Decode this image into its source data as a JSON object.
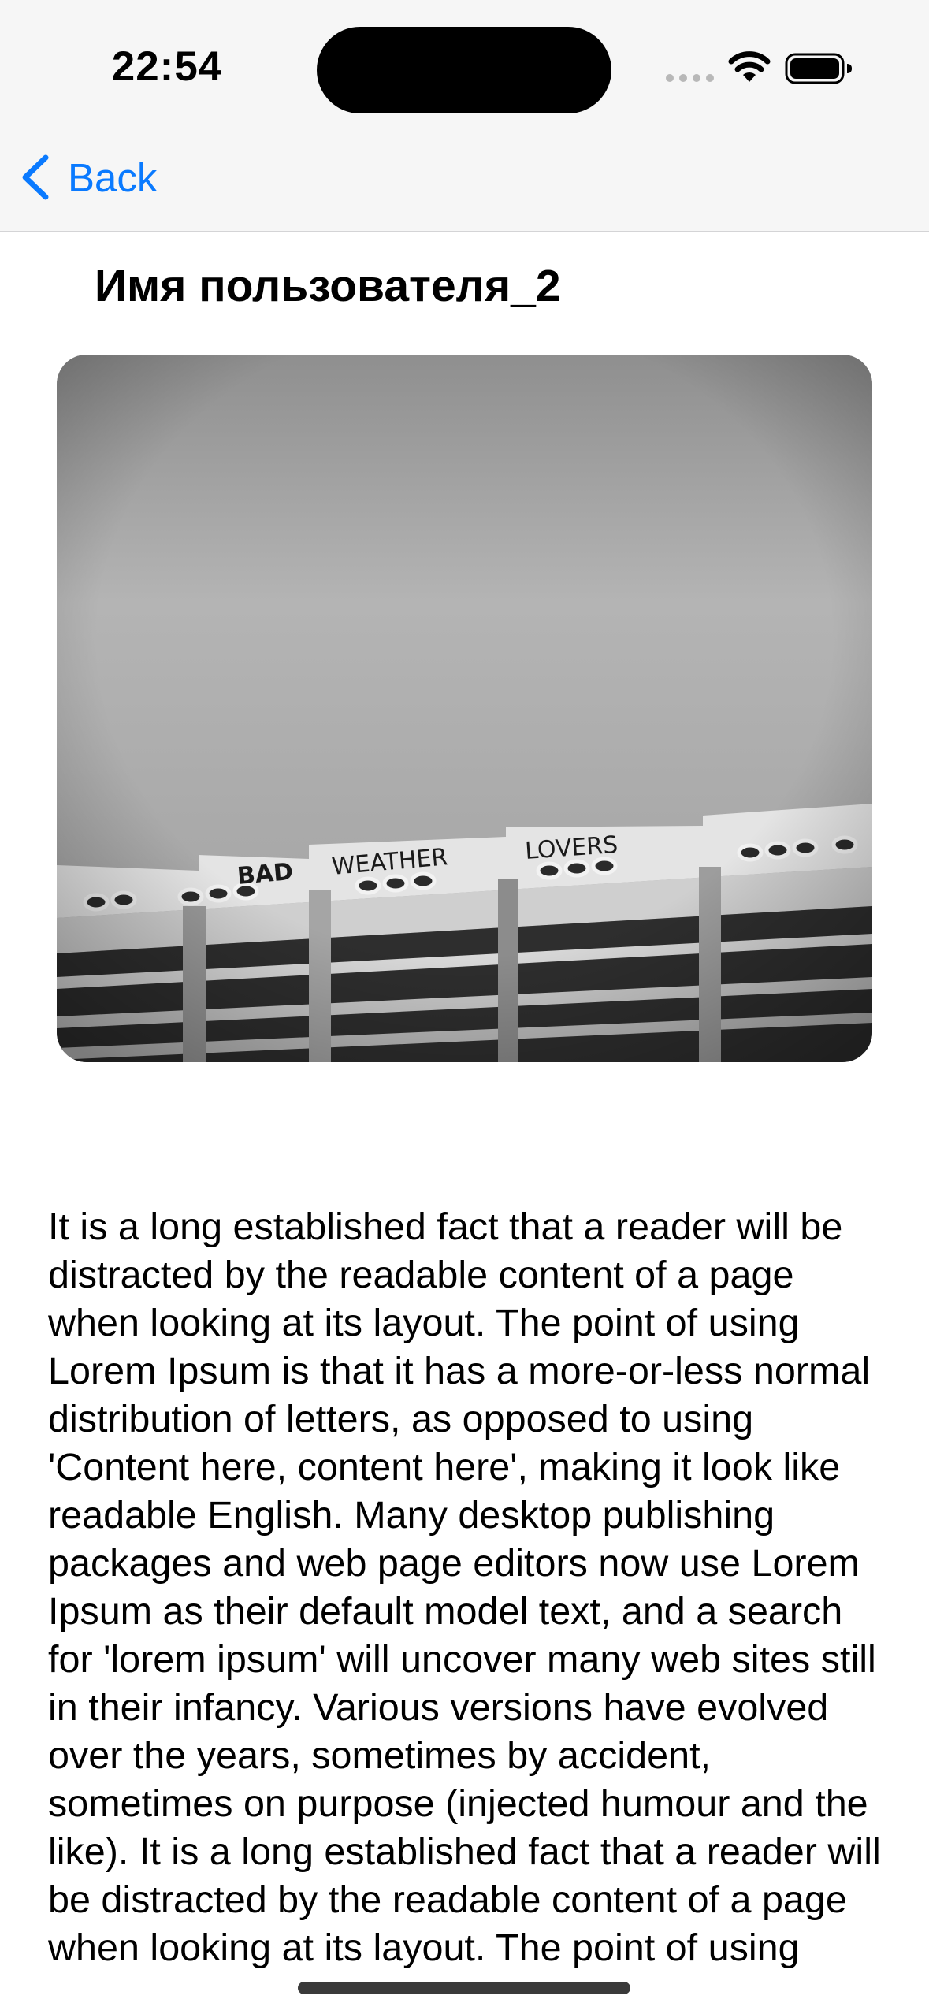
{
  "status_bar": {
    "time": "22:54"
  },
  "nav": {
    "back_label": "Back"
  },
  "post": {
    "username": "Имя пользователя_2",
    "image_graffiti": "BAD WEATHER LOVERS",
    "text": "It is a long established fact that a reader will be distracted by the readable content of a page when looking at its layout. The point of using Lorem Ipsum is that it has a more-or-less normal distribution of letters, as opposed to using 'Content here, content here', making it look like readable English. Many desktop publishing packages and web page editors now use Lorem Ipsum as their default model text, and a search for 'lorem ipsum' will uncover many web sites still in their infancy. Various versions have evolved over the years, sometimes by accident, sometimes on purpose (injected humour and the like). It is a long established fact that a reader will be distracted by the readable content of a page when looking at its layout. The point of using"
  },
  "colors": {
    "accent": "#0a7aff",
    "nav_background": "#f6f6f6",
    "separator": "#d4d4d6"
  },
  "icons": {
    "back": "chevron-left-icon",
    "wifi": "wifi-icon",
    "battery": "battery-icon",
    "cellular": "cellular-dots-icon"
  }
}
